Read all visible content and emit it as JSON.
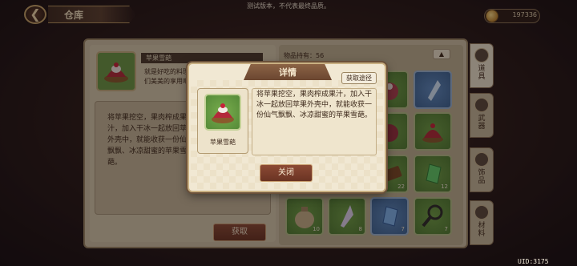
{
  "top_notice": "测试版本，不代表最终品质。",
  "header": {
    "title": "仓库",
    "back_icon": "back-arrow-icon"
  },
  "currency": {
    "icon": "coin-icon",
    "amount": "197336"
  },
  "selected_item": {
    "name": "苹果雪葩",
    "short_desc": "就是好吃的料理，们美美的享用吧",
    "long_desc": "将苹果挖空，果肉榨成果汁，加入干冰一起放回苹果外壳中，就能收获一份仙气飘飘、冰凉甜蜜的苹果雪葩。",
    "get_button": "获取"
  },
  "inventory": {
    "count_label": "物品持有：56",
    "up_icon": "up-arrow-icon",
    "slots": [
      {
        "color": "green",
        "icon": "apple-sorbet-icon",
        "count": ""
      },
      {
        "color": "blue",
        "icon": "crystal-icon",
        "count": ""
      },
      {
        "color": "green",
        "icon": "dessert-icon",
        "count": ""
      },
      {
        "color": "green",
        "icon": "apple-sorbet-icon",
        "count": ""
      },
      {
        "color": "green",
        "icon": "wood-icon",
        "count": "22"
      },
      {
        "color": "green",
        "icon": "green-gem-icon",
        "count": "12"
      },
      {
        "color": "green",
        "icon": "bag-icon",
        "count": "10"
      },
      {
        "color": "green",
        "icon": "crystal-shard-icon",
        "count": "8"
      },
      {
        "color": "blue",
        "icon": "blue-gem-icon",
        "count": "7"
      },
      {
        "color": "green",
        "icon": "magnifier-icon",
        "count": "7"
      }
    ]
  },
  "tabs": [
    {
      "label": "道具",
      "active": true
    },
    {
      "label": "武器",
      "active": false
    },
    {
      "label": "饰品",
      "active": false
    },
    {
      "label": "材料",
      "active": false
    }
  ],
  "modal": {
    "title": "详情",
    "source_button": "获取途径",
    "item_name": "苹果雪葩",
    "description": "将苹果挖空，果肉榨成果汁，加入干冰一起放回苹果外壳中，就能收获一份仙气飘飘、冰凉甜蜜的苹果雪葩。",
    "close_button": "关闭"
  },
  "uid": "UID:3175"
}
